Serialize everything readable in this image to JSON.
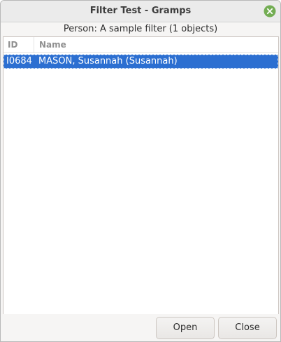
{
  "window": {
    "title": "Filter Test - Gramps",
    "close_icon": "close-icon",
    "close_color": "#73ad53"
  },
  "subtitle": "Person: A sample filter (1 objects)",
  "list": {
    "columns": [
      "ID",
      "Name"
    ],
    "rows": [
      {
        "id": "I0684",
        "name": "MASON, Susannah (Susannah)",
        "selected": true
      }
    ],
    "selection_color": "#2c6fd1"
  },
  "buttons": {
    "open": "Open",
    "close": "Close"
  }
}
